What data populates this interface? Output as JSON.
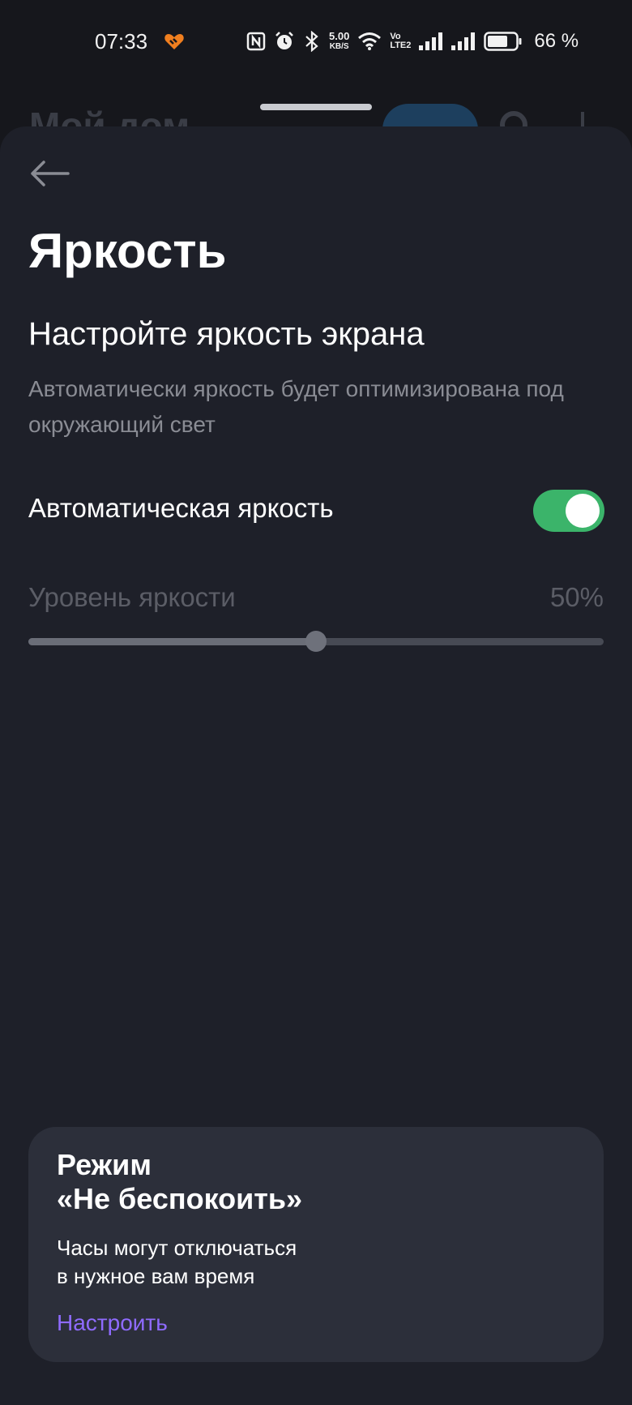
{
  "status_bar": {
    "time": "07:33",
    "net_speed_value": "5.00",
    "net_speed_unit": "KB/S",
    "volte_top": "Vo",
    "volte_bottom": "LTE2",
    "battery_percent": "66 %",
    "icons": [
      "heart-app-icon",
      "nfc-icon",
      "alarm-icon",
      "bluetooth-icon",
      "wifi-icon",
      "signal-icon",
      "signal-icon",
      "battery-icon"
    ]
  },
  "background_app": {
    "title_partial": "Мой дом"
  },
  "header": {
    "back_icon": "arrow-left-icon",
    "title": "Яркость"
  },
  "brightness": {
    "subtitle": "Настройте яркость экрана",
    "description": "Автоматически яркость будет оптимизирована под окружающий свет",
    "auto_label": "Автоматическая яркость",
    "auto_enabled": true,
    "level_label": "Уровень яркости",
    "level_value_text": "50%",
    "level_fraction": 0.5
  },
  "dnd_card": {
    "title_line1": "Режим",
    "title_line2": "«Не беспокоить»",
    "text_line1": "Часы могут отключаться",
    "text_line2": "в нужное вам время",
    "link_label": "Настроить"
  },
  "colors": {
    "toggle_on": "#3bb46a",
    "link": "#8f6bff",
    "sheet_bg": "#1e2029",
    "card_bg": "#2c2f3a"
  }
}
